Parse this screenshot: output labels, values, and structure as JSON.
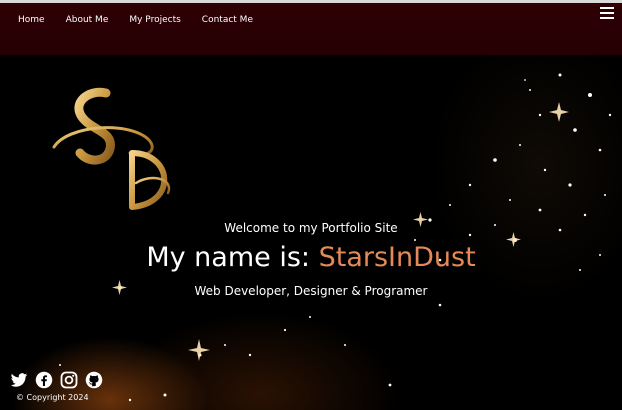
{
  "nav": {
    "items": [
      {
        "label": "Home"
      },
      {
        "label": "About Me"
      },
      {
        "label": "My Projects"
      },
      {
        "label": "Contact Me"
      }
    ],
    "menu_icon": "hamburger-menu-icon"
  },
  "hero": {
    "logo_text": "SID",
    "welcome": "Welcome to my Portfolio Site",
    "name_prefix": "My name is: ",
    "name": "StarsInDust",
    "role": "Web Developer, Designer & Programer"
  },
  "footer": {
    "socials": [
      "twitter-icon",
      "facebook-icon",
      "instagram-icon",
      "github-icon"
    ],
    "copyright": "© Copyright 2024"
  },
  "colors": {
    "navbar": "#2e0004",
    "accent": "#e58a57",
    "logo_gold": "#d4a84a"
  }
}
